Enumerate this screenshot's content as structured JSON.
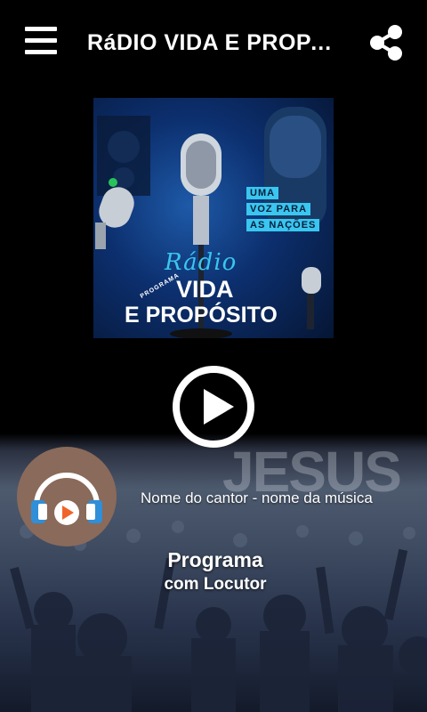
{
  "header": {
    "title": "RáDIO VIDA E PROPA…",
    "menu_icon": "hamburger-menu-icon",
    "share_icon": "share-icon"
  },
  "cover": {
    "tagline": [
      "UMA",
      "VOZ PARA",
      "AS NAÇÕES"
    ],
    "radio_word": "Rádio",
    "programa_word": "PROGRAMA",
    "vida_word": "VIDA",
    "proposito_word": "E PROPÓSITO"
  },
  "player": {
    "play_icon": "play-icon",
    "avatar_icon": "headphones-play-icon",
    "song": "Nome do cantor - nome da música",
    "program": "Programa",
    "host": "com Locutor"
  },
  "background": {
    "word": "JESUS"
  },
  "colors": {
    "background": "#000000",
    "accent": "#39c6f0",
    "avatar_bg": "#8a6a5a",
    "headphone_blue": "#2f8fd8",
    "play_orange": "#f0642a"
  }
}
